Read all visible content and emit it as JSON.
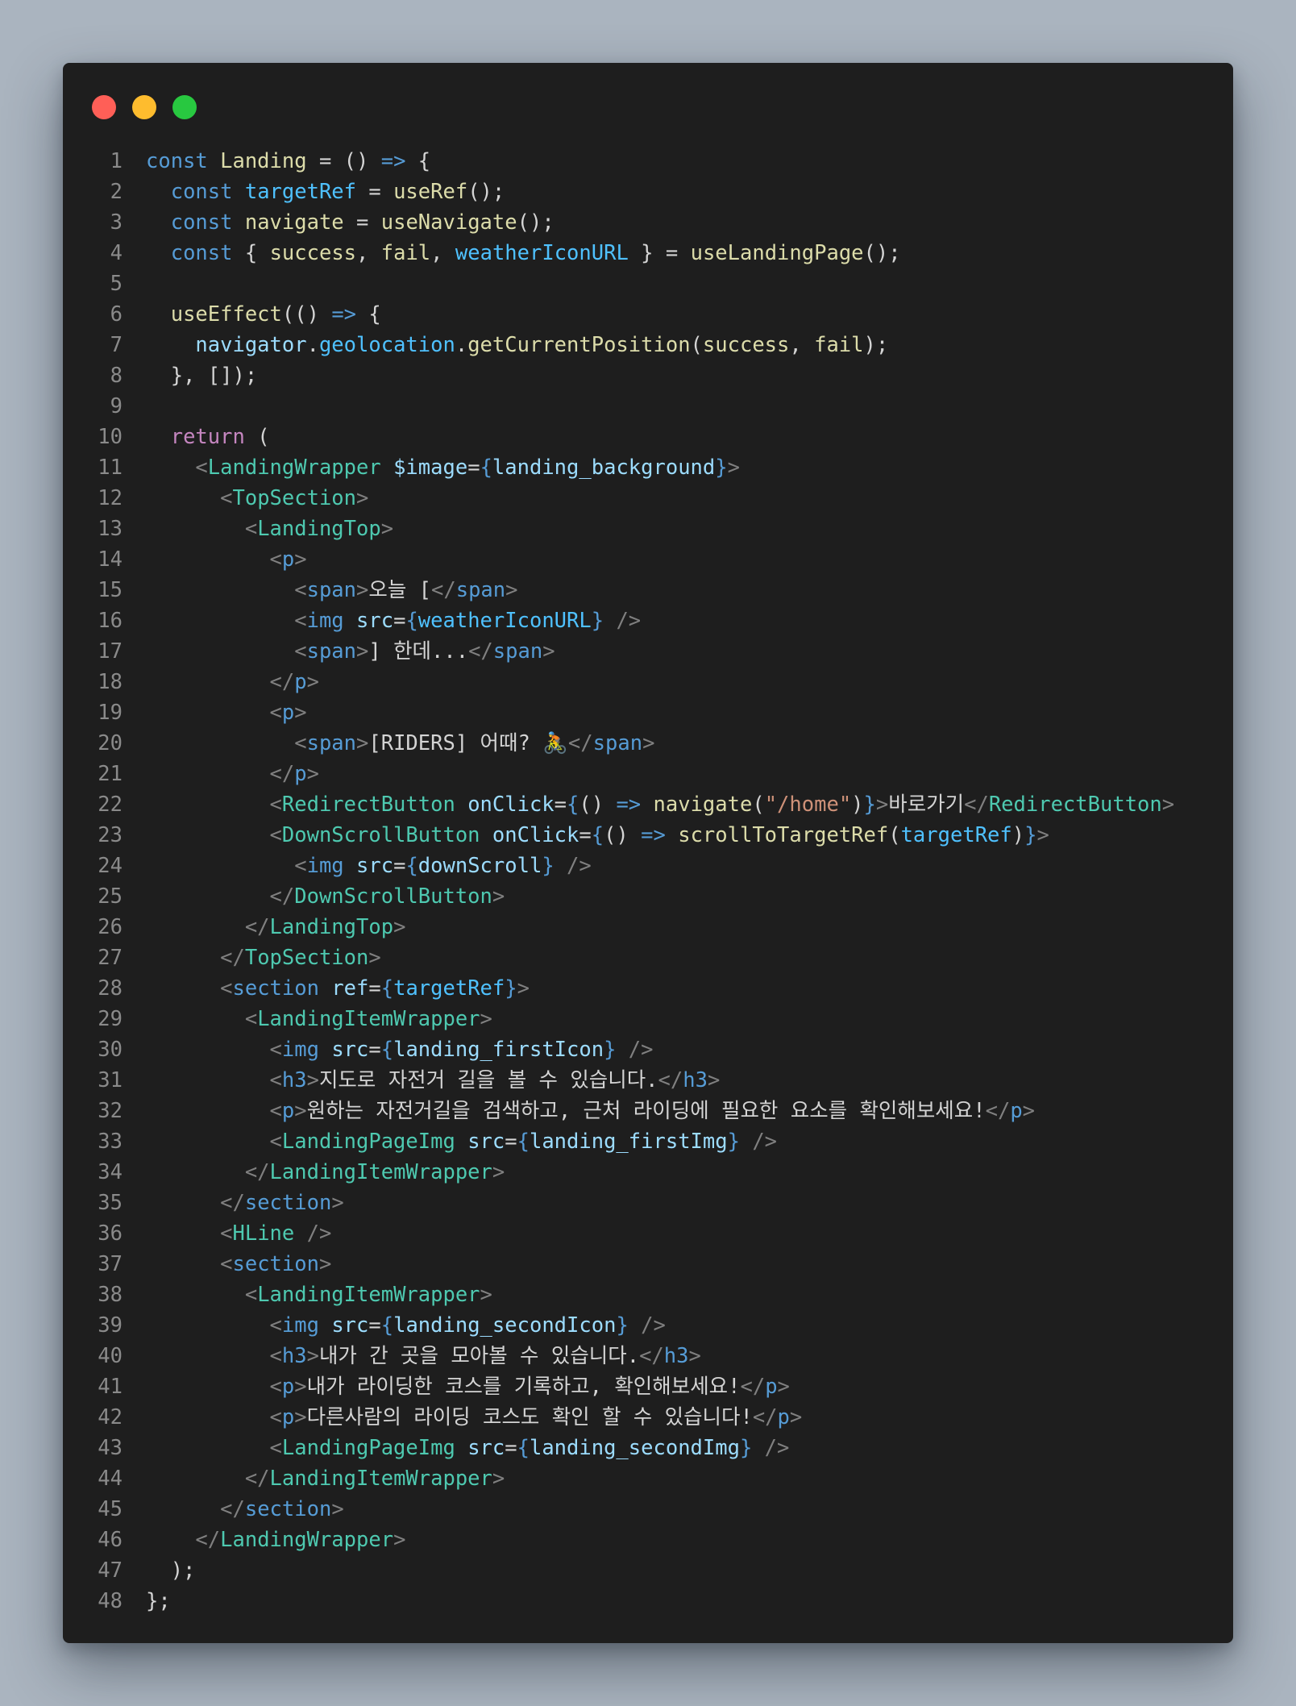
{
  "window": {
    "buttons": [
      {
        "name": "close",
        "color": "#ff5f57"
      },
      {
        "name": "minimize",
        "color": "#febc2e"
      },
      {
        "name": "zoom",
        "color": "#28c840"
      }
    ]
  },
  "colors": {
    "background": "#aab4bf",
    "editor": "#1e1e1e",
    "line_number": "#8a8a8a",
    "plain": "#d4d4d4",
    "keyword": "#569cd6",
    "function": "#dcdcaa",
    "variable": "#9cdcfe",
    "constant": "#4fc1ff",
    "control": "#c586c0",
    "tag": "#4ec9b0",
    "bracket": "#808080",
    "string": "#ce9178"
  },
  "code_lines": [
    [
      [
        "const ",
        "keyword"
      ],
      [
        "Landing",
        "function"
      ],
      [
        " = () ",
        "plain"
      ],
      [
        "=>",
        "keyword"
      ],
      [
        " {",
        "plain"
      ]
    ],
    [
      [
        "  ",
        "plain"
      ],
      [
        "const ",
        "keyword"
      ],
      [
        "targetRef",
        "constant"
      ],
      [
        " = ",
        "plain"
      ],
      [
        "useRef",
        "function"
      ],
      [
        "();",
        "plain"
      ]
    ],
    [
      [
        "  ",
        "plain"
      ],
      [
        "const ",
        "keyword"
      ],
      [
        "navigate",
        "function"
      ],
      [
        " = ",
        "plain"
      ],
      [
        "useNavigate",
        "function"
      ],
      [
        "();",
        "plain"
      ]
    ],
    [
      [
        "  ",
        "plain"
      ],
      [
        "const ",
        "keyword"
      ],
      [
        "{ ",
        "plain"
      ],
      [
        "success",
        "function"
      ],
      [
        ", ",
        "plain"
      ],
      [
        "fail",
        "function"
      ],
      [
        ", ",
        "plain"
      ],
      [
        "weatherIconURL",
        "constant"
      ],
      [
        " } = ",
        "plain"
      ],
      [
        "useLandingPage",
        "function"
      ],
      [
        "();",
        "plain"
      ]
    ],
    [],
    [
      [
        "  ",
        "plain"
      ],
      [
        "useEffect",
        "function"
      ],
      [
        "(() ",
        "plain"
      ],
      [
        "=>",
        "keyword"
      ],
      [
        " {",
        "plain"
      ]
    ],
    [
      [
        "    ",
        "plain"
      ],
      [
        "navigator",
        "variable"
      ],
      [
        ".",
        "plain"
      ],
      [
        "geolocation",
        "constant"
      ],
      [
        ".",
        "plain"
      ],
      [
        "getCurrentPosition",
        "function"
      ],
      [
        "(",
        "plain"
      ],
      [
        "success",
        "function"
      ],
      [
        ", ",
        "plain"
      ],
      [
        "fail",
        "function"
      ],
      [
        ");",
        "plain"
      ]
    ],
    [
      [
        "  }, []);",
        "plain"
      ]
    ],
    [],
    [
      [
        "  ",
        "plain"
      ],
      [
        "return",
        "control"
      ],
      [
        " (",
        "plain"
      ]
    ],
    [
      [
        "    ",
        "plain"
      ],
      [
        "<",
        "bracket"
      ],
      [
        "LandingWrapper",
        "tag"
      ],
      [
        " ",
        "plain"
      ],
      [
        "$image",
        "variable"
      ],
      [
        "=",
        "plain"
      ],
      [
        "{",
        "keyword"
      ],
      [
        "landing_background",
        "variable"
      ],
      [
        "}",
        "keyword"
      ],
      [
        ">",
        "bracket"
      ]
    ],
    [
      [
        "      ",
        "plain"
      ],
      [
        "<",
        "bracket"
      ],
      [
        "TopSection",
        "tag"
      ],
      [
        ">",
        "bracket"
      ]
    ],
    [
      [
        "        ",
        "plain"
      ],
      [
        "<",
        "bracket"
      ],
      [
        "LandingTop",
        "tag"
      ],
      [
        ">",
        "bracket"
      ]
    ],
    [
      [
        "          ",
        "plain"
      ],
      [
        "<",
        "bracket"
      ],
      [
        "p",
        "keyword"
      ],
      [
        ">",
        "bracket"
      ]
    ],
    [
      [
        "            ",
        "plain"
      ],
      [
        "<",
        "bracket"
      ],
      [
        "span",
        "keyword"
      ],
      [
        ">",
        "bracket"
      ],
      [
        "오늘 [",
        "plain"
      ],
      [
        "</",
        "bracket"
      ],
      [
        "span",
        "keyword"
      ],
      [
        ">",
        "bracket"
      ]
    ],
    [
      [
        "            ",
        "plain"
      ],
      [
        "<",
        "bracket"
      ],
      [
        "img",
        "keyword"
      ],
      [
        " ",
        "plain"
      ],
      [
        "src",
        "variable"
      ],
      [
        "=",
        "plain"
      ],
      [
        "{",
        "keyword"
      ],
      [
        "weatherIconURL",
        "constant"
      ],
      [
        "}",
        "keyword"
      ],
      [
        " />",
        "bracket"
      ]
    ],
    [
      [
        "            ",
        "plain"
      ],
      [
        "<",
        "bracket"
      ],
      [
        "span",
        "keyword"
      ],
      [
        ">",
        "bracket"
      ],
      [
        "] 한데...",
        "plain"
      ],
      [
        "</",
        "bracket"
      ],
      [
        "span",
        "keyword"
      ],
      [
        ">",
        "bracket"
      ]
    ],
    [
      [
        "          ",
        "plain"
      ],
      [
        "</",
        "bracket"
      ],
      [
        "p",
        "keyword"
      ],
      [
        ">",
        "bracket"
      ]
    ],
    [
      [
        "          ",
        "plain"
      ],
      [
        "<",
        "bracket"
      ],
      [
        "p",
        "keyword"
      ],
      [
        ">",
        "bracket"
      ]
    ],
    [
      [
        "            ",
        "plain"
      ],
      [
        "<",
        "bracket"
      ],
      [
        "span",
        "keyword"
      ],
      [
        ">",
        "bracket"
      ],
      [
        "[RIDERS] 어때? 🚴",
        "plain"
      ],
      [
        "</",
        "bracket"
      ],
      [
        "span",
        "keyword"
      ],
      [
        ">",
        "bracket"
      ]
    ],
    [
      [
        "          ",
        "plain"
      ],
      [
        "</",
        "bracket"
      ],
      [
        "p",
        "keyword"
      ],
      [
        ">",
        "bracket"
      ]
    ],
    [
      [
        "          ",
        "plain"
      ],
      [
        "<",
        "bracket"
      ],
      [
        "RedirectButton",
        "tag"
      ],
      [
        " ",
        "plain"
      ],
      [
        "onClick",
        "variable"
      ],
      [
        "=",
        "plain"
      ],
      [
        "{",
        "keyword"
      ],
      [
        "() ",
        "plain"
      ],
      [
        "=>",
        "keyword"
      ],
      [
        " ",
        "plain"
      ],
      [
        "navigate",
        "function"
      ],
      [
        "(",
        "plain"
      ],
      [
        "\"/home\"",
        "string"
      ],
      [
        ")",
        "plain"
      ],
      [
        "}",
        "keyword"
      ],
      [
        ">",
        "bracket"
      ],
      [
        "바로가기",
        "plain"
      ],
      [
        "</",
        "bracket"
      ],
      [
        "RedirectButton",
        "tag"
      ],
      [
        ">",
        "bracket"
      ]
    ],
    [
      [
        "          ",
        "plain"
      ],
      [
        "<",
        "bracket"
      ],
      [
        "DownScrollButton",
        "tag"
      ],
      [
        " ",
        "plain"
      ],
      [
        "onClick",
        "variable"
      ],
      [
        "=",
        "plain"
      ],
      [
        "{",
        "keyword"
      ],
      [
        "() ",
        "plain"
      ],
      [
        "=>",
        "keyword"
      ],
      [
        " ",
        "plain"
      ],
      [
        "scrollToTargetRef",
        "function"
      ],
      [
        "(",
        "plain"
      ],
      [
        "targetRef",
        "constant"
      ],
      [
        ")",
        "plain"
      ],
      [
        "}",
        "keyword"
      ],
      [
        ">",
        "bracket"
      ]
    ],
    [
      [
        "            ",
        "plain"
      ],
      [
        "<",
        "bracket"
      ],
      [
        "img",
        "keyword"
      ],
      [
        " ",
        "plain"
      ],
      [
        "src",
        "variable"
      ],
      [
        "=",
        "plain"
      ],
      [
        "{",
        "keyword"
      ],
      [
        "downScroll",
        "variable"
      ],
      [
        "}",
        "keyword"
      ],
      [
        " />",
        "bracket"
      ]
    ],
    [
      [
        "          ",
        "plain"
      ],
      [
        "</",
        "bracket"
      ],
      [
        "DownScrollButton",
        "tag"
      ],
      [
        ">",
        "bracket"
      ]
    ],
    [
      [
        "        ",
        "plain"
      ],
      [
        "</",
        "bracket"
      ],
      [
        "LandingTop",
        "tag"
      ],
      [
        ">",
        "bracket"
      ]
    ],
    [
      [
        "      ",
        "plain"
      ],
      [
        "</",
        "bracket"
      ],
      [
        "TopSection",
        "tag"
      ],
      [
        ">",
        "bracket"
      ]
    ],
    [
      [
        "      ",
        "plain"
      ],
      [
        "<",
        "bracket"
      ],
      [
        "section",
        "keyword"
      ],
      [
        " ",
        "plain"
      ],
      [
        "ref",
        "variable"
      ],
      [
        "=",
        "plain"
      ],
      [
        "{",
        "keyword"
      ],
      [
        "targetRef",
        "constant"
      ],
      [
        "}",
        "keyword"
      ],
      [
        ">",
        "bracket"
      ]
    ],
    [
      [
        "        ",
        "plain"
      ],
      [
        "<",
        "bracket"
      ],
      [
        "LandingItemWrapper",
        "tag"
      ],
      [
        ">",
        "bracket"
      ]
    ],
    [
      [
        "          ",
        "plain"
      ],
      [
        "<",
        "bracket"
      ],
      [
        "img",
        "keyword"
      ],
      [
        " ",
        "plain"
      ],
      [
        "src",
        "variable"
      ],
      [
        "=",
        "plain"
      ],
      [
        "{",
        "keyword"
      ],
      [
        "landing_firstIcon",
        "variable"
      ],
      [
        "}",
        "keyword"
      ],
      [
        " />",
        "bracket"
      ]
    ],
    [
      [
        "          ",
        "plain"
      ],
      [
        "<",
        "bracket"
      ],
      [
        "h3",
        "keyword"
      ],
      [
        ">",
        "bracket"
      ],
      [
        "지도로 자전거 길을 볼 수 있습니다.",
        "plain"
      ],
      [
        "</",
        "bracket"
      ],
      [
        "h3",
        "keyword"
      ],
      [
        ">",
        "bracket"
      ]
    ],
    [
      [
        "          ",
        "plain"
      ],
      [
        "<",
        "bracket"
      ],
      [
        "p",
        "keyword"
      ],
      [
        ">",
        "bracket"
      ],
      [
        "원하는 자전거길을 검색하고, 근처 라이딩에 필요한 요소를 확인해보세요!",
        "plain"
      ],
      [
        "</",
        "bracket"
      ],
      [
        "p",
        "keyword"
      ],
      [
        ">",
        "bracket"
      ]
    ],
    [
      [
        "          ",
        "plain"
      ],
      [
        "<",
        "bracket"
      ],
      [
        "LandingPageImg",
        "tag"
      ],
      [
        " ",
        "plain"
      ],
      [
        "src",
        "variable"
      ],
      [
        "=",
        "plain"
      ],
      [
        "{",
        "keyword"
      ],
      [
        "landing_firstImg",
        "variable"
      ],
      [
        "}",
        "keyword"
      ],
      [
        " />",
        "bracket"
      ]
    ],
    [
      [
        "        ",
        "plain"
      ],
      [
        "</",
        "bracket"
      ],
      [
        "LandingItemWrapper",
        "tag"
      ],
      [
        ">",
        "bracket"
      ]
    ],
    [
      [
        "      ",
        "plain"
      ],
      [
        "</",
        "bracket"
      ],
      [
        "section",
        "keyword"
      ],
      [
        ">",
        "bracket"
      ]
    ],
    [
      [
        "      ",
        "plain"
      ],
      [
        "<",
        "bracket"
      ],
      [
        "HLine",
        "tag"
      ],
      [
        " />",
        "bracket"
      ]
    ],
    [
      [
        "      ",
        "plain"
      ],
      [
        "<",
        "bracket"
      ],
      [
        "section",
        "keyword"
      ],
      [
        ">",
        "bracket"
      ]
    ],
    [
      [
        "        ",
        "plain"
      ],
      [
        "<",
        "bracket"
      ],
      [
        "LandingItemWrapper",
        "tag"
      ],
      [
        ">",
        "bracket"
      ]
    ],
    [
      [
        "          ",
        "plain"
      ],
      [
        "<",
        "bracket"
      ],
      [
        "img",
        "keyword"
      ],
      [
        " ",
        "plain"
      ],
      [
        "src",
        "variable"
      ],
      [
        "=",
        "plain"
      ],
      [
        "{",
        "keyword"
      ],
      [
        "landing_secondIcon",
        "variable"
      ],
      [
        "}",
        "keyword"
      ],
      [
        " />",
        "bracket"
      ]
    ],
    [
      [
        "          ",
        "plain"
      ],
      [
        "<",
        "bracket"
      ],
      [
        "h3",
        "keyword"
      ],
      [
        ">",
        "bracket"
      ],
      [
        "내가 간 곳을 모아볼 수 있습니다.",
        "plain"
      ],
      [
        "</",
        "bracket"
      ],
      [
        "h3",
        "keyword"
      ],
      [
        ">",
        "bracket"
      ]
    ],
    [
      [
        "          ",
        "plain"
      ],
      [
        "<",
        "bracket"
      ],
      [
        "p",
        "keyword"
      ],
      [
        ">",
        "bracket"
      ],
      [
        "내가 라이딩한 코스를 기록하고, 확인해보세요!",
        "plain"
      ],
      [
        "</",
        "bracket"
      ],
      [
        "p",
        "keyword"
      ],
      [
        ">",
        "bracket"
      ]
    ],
    [
      [
        "          ",
        "plain"
      ],
      [
        "<",
        "bracket"
      ],
      [
        "p",
        "keyword"
      ],
      [
        ">",
        "bracket"
      ],
      [
        "다른사람의 라이딩 코스도 확인 할 수 있습니다!",
        "plain"
      ],
      [
        "</",
        "bracket"
      ],
      [
        "p",
        "keyword"
      ],
      [
        ">",
        "bracket"
      ]
    ],
    [
      [
        "          ",
        "plain"
      ],
      [
        "<",
        "bracket"
      ],
      [
        "LandingPageImg",
        "tag"
      ],
      [
        " ",
        "plain"
      ],
      [
        "src",
        "variable"
      ],
      [
        "=",
        "plain"
      ],
      [
        "{",
        "keyword"
      ],
      [
        "landing_secondImg",
        "variable"
      ],
      [
        "}",
        "keyword"
      ],
      [
        " />",
        "bracket"
      ]
    ],
    [
      [
        "        ",
        "plain"
      ],
      [
        "</",
        "bracket"
      ],
      [
        "LandingItemWrapper",
        "tag"
      ],
      [
        ">",
        "bracket"
      ]
    ],
    [
      [
        "      ",
        "plain"
      ],
      [
        "</",
        "bracket"
      ],
      [
        "section",
        "keyword"
      ],
      [
        ">",
        "bracket"
      ]
    ],
    [
      [
        "    ",
        "plain"
      ],
      [
        "</",
        "bracket"
      ],
      [
        "LandingWrapper",
        "tag"
      ],
      [
        ">",
        "bracket"
      ]
    ],
    [
      [
        "  );",
        "plain"
      ]
    ],
    [
      [
        "};",
        "plain"
      ]
    ]
  ]
}
